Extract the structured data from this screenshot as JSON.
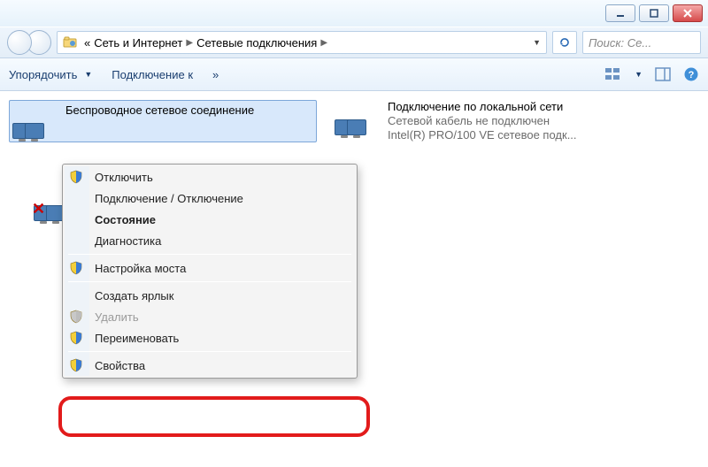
{
  "breadcrumbs": {
    "prefix": "«",
    "seg1": "Сеть и Интернет",
    "seg2": "Сетевые подключения"
  },
  "search": {
    "placeholder": "Поиск: Се..."
  },
  "toolbar": {
    "organize": "Упорядочить",
    "connect_to": "Подключение к",
    "overflow": "»"
  },
  "connections": {
    "wireless": {
      "title": "Беспроводное сетевое соединение"
    },
    "lan": {
      "title": "Подключение по локальной сети",
      "line1": "Сетевой кабель не подключен",
      "line2": "Intel(R) PRO/100 VE сетевое подк..."
    }
  },
  "context_menu": {
    "items": [
      {
        "label": "Отключить",
        "shield": true
      },
      {
        "label": "Подключение / Отключение"
      },
      {
        "label": "Состояние",
        "bold": true
      },
      {
        "label": "Диагностика"
      },
      {
        "sep": true
      },
      {
        "label": "Настройка моста",
        "shield": true
      },
      {
        "sep": true
      },
      {
        "label": "Создать ярлык"
      },
      {
        "label": "Удалить",
        "disabled": true,
        "shield": true,
        "shield_disabled": true
      },
      {
        "label": "Переименовать",
        "shield": true
      },
      {
        "sep": true
      },
      {
        "label": "Свойства",
        "shield": true
      }
    ]
  }
}
